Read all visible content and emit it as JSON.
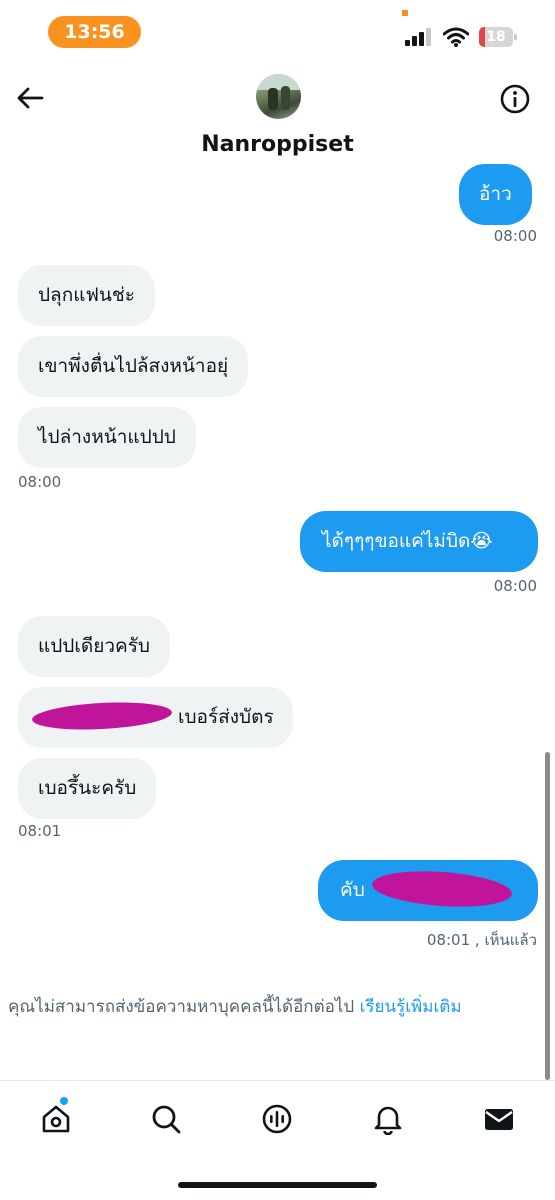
{
  "status_bar": {
    "time": "13:56",
    "battery_level": "18",
    "battery_fraction": 0.18,
    "signal_icon": "cellular-signal-icon",
    "wifi_icon": "wifi-icon",
    "colors": {
      "time_pill": "#f7931e",
      "battery_low": "#e0474c"
    }
  },
  "header": {
    "contact_name": "Nanroppiset",
    "back_icon": "arrow-left-icon",
    "info_icon": "info-circle-icon"
  },
  "messages": [
    {
      "direction": "out",
      "text": "อ้าว"
    },
    {
      "direction": "out_time",
      "text": "08:00"
    },
    {
      "direction": "in",
      "text": "ปลุกแฟนช่ะ"
    },
    {
      "direction": "in",
      "text": "เขาพึ่งตื่นไปล้สงหน้าอยุ่"
    },
    {
      "direction": "in",
      "text": "ไปล่างหน้าแปปป"
    },
    {
      "direction": "in_time",
      "text": "08:00"
    },
    {
      "direction": "out",
      "text": "ได้ๆๆๆขอแค่ไม่บิด😭"
    },
    {
      "direction": "out_time",
      "text": "08:00"
    },
    {
      "direction": "in",
      "text": "แปปเดียวครับ"
    },
    {
      "direction": "in",
      "text": "เบอร์ส่งบัตร"
    },
    {
      "direction": "in",
      "text": "เบอรึ้นะครับ"
    },
    {
      "direction": "in_time",
      "text": "08:01"
    },
    {
      "direction": "out",
      "text": "คับ"
    },
    {
      "direction": "out_time",
      "text": "08:01 , เห็นแล้ว"
    }
  ],
  "notice": {
    "text": "คุณไม่สามารถส่งข้อความหาบุคคลนี้ได้อีกต่อไป",
    "link": "เรียนรู้เพิ่มเติม"
  },
  "bottom_nav": {
    "items": [
      "home-icon",
      "search-icon",
      "spaces-icon",
      "bell-icon",
      "mail-icon"
    ],
    "accent": "#1d9bf0"
  },
  "colors": {
    "bubble_out": "#1d9bf0",
    "bubble_in": "#eff3f4",
    "redaction": "#c0159a"
  }
}
